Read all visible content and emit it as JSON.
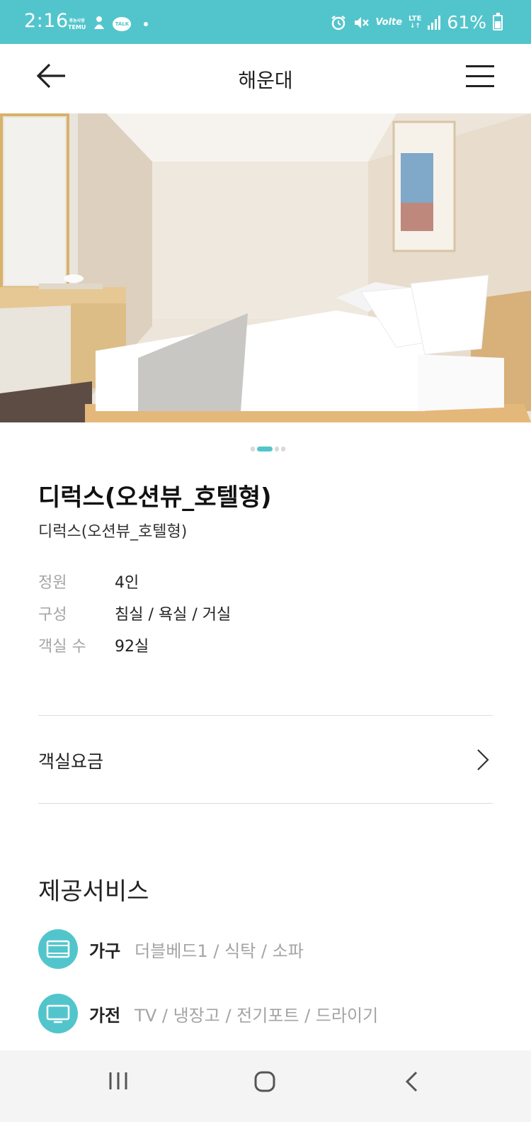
{
  "status_bar": {
    "time": "2:16",
    "temu_small": "휴농사랑",
    "temu": "TEMU",
    "talk": "TALK",
    "volte": "Volte",
    "lte": "LTE",
    "battery": "61%",
    "icons": [
      "temu-icon",
      "person-icon",
      "talk-icon",
      "alarm-icon",
      "mute-icon",
      "signal-icon",
      "battery-icon"
    ]
  },
  "header": {
    "title": "해운대"
  },
  "gallery": {
    "pages": 4,
    "active_index": 1
  },
  "room": {
    "name": "디럭스(오션뷰_호텔형)",
    "subtitle": "디럭스(오션뷰_호텔형)"
  },
  "specs": [
    {
      "label": "정원",
      "value": "4인"
    },
    {
      "label": "구성",
      "value": "침실 / 욕실 / 거실"
    },
    {
      "label": "객실 수",
      "value": "92실"
    }
  ],
  "rate": {
    "label": "객실요금"
  },
  "services": {
    "title": "제공서비스",
    "items": [
      {
        "label": "가구",
        "value": "더블베드1 / 식탁 / 소파",
        "icon": "bed-icon"
      },
      {
        "label": "가전",
        "value": "TV / 냉장고 / 전기포트 / 드라이기",
        "icon": "tv-icon"
      }
    ]
  },
  "colors": {
    "accent": "#52c5cc",
    "muted_text": "#a4a4a4",
    "nav_bg": "#f4f4f4"
  }
}
